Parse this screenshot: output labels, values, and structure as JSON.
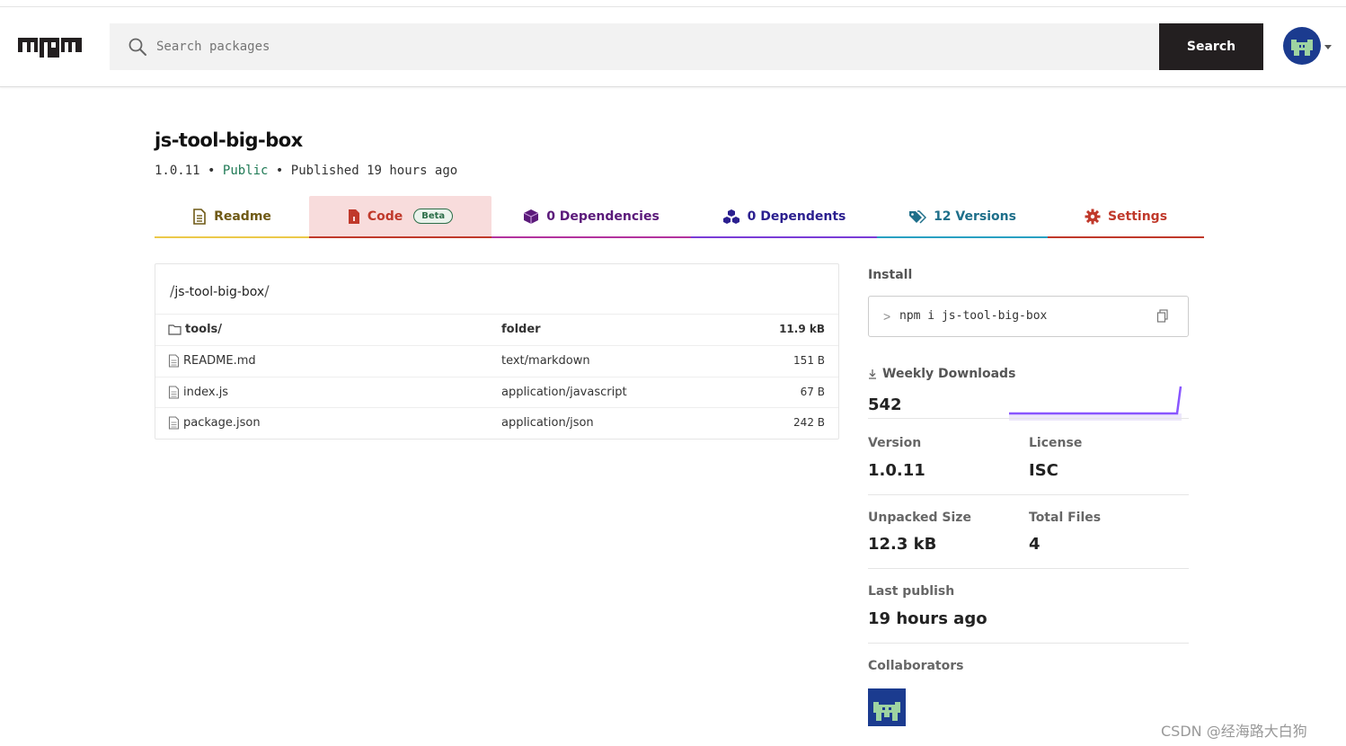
{
  "header": {
    "logo_text": "npm",
    "search_placeholder": "Search packages",
    "search_button": "Search"
  },
  "package": {
    "name": "js-tool-big-box",
    "version": "1.0.11",
    "visibility": "Public",
    "published": "Published 19 hours ago",
    "dot": "•"
  },
  "tabs": [
    {
      "label": "Readme",
      "icon": "readme-icon",
      "color": "#6f5a16"
    },
    {
      "label": "Code",
      "icon": "code-icon",
      "badge": "Beta",
      "color": "#c0392b",
      "active": true
    },
    {
      "label": "0 Dependencies",
      "icon": "box-icon",
      "color": "#5b1a7a"
    },
    {
      "label": "0 Dependents",
      "icon": "boxes-icon",
      "color": "#2b1f8f"
    },
    {
      "label": "12 Versions",
      "icon": "tags-icon",
      "color": "#1e6f8a"
    },
    {
      "label": "Settings",
      "icon": "gear-icon",
      "color": "#c0392b"
    }
  ],
  "file_browser": {
    "path_sep_open": "/",
    "path": "js-tool-big-box",
    "path_sep_close": "/",
    "rows": [
      {
        "name": "tools/",
        "type": "folder",
        "size": "11.9 kB",
        "kind": "folder"
      },
      {
        "name": "README.md",
        "type": "text/markdown",
        "size": "151 B",
        "kind": "file"
      },
      {
        "name": "index.js",
        "type": "application/javascript",
        "size": "67 B",
        "kind": "file"
      },
      {
        "name": "package.json",
        "type": "application/json",
        "size": "242 B",
        "kind": "file"
      }
    ]
  },
  "sidebar": {
    "install_label": "Install",
    "install_prompt": ">",
    "install_cmd": "npm i js-tool-big-box",
    "weekly_label": "Weekly Downloads",
    "weekly_value": "542",
    "version_label": "Version",
    "version_value": "1.0.11",
    "license_label": "License",
    "license_value": "ISC",
    "unpacked_label": "Unpacked Size",
    "unpacked_value": "12.3 kB",
    "files_label": "Total Files",
    "files_value": "4",
    "last_label": "Last publish",
    "last_value": "19 hours ago",
    "collab_label": "Collaborators"
  },
  "watermark": "CSDN @经海路大白狗",
  "colors": {
    "accent_purple": "#8956ff",
    "header_dark": "#231f20",
    "avatar_bg": "#1b3b8f",
    "avatar_fg": "#9ed3a1"
  }
}
